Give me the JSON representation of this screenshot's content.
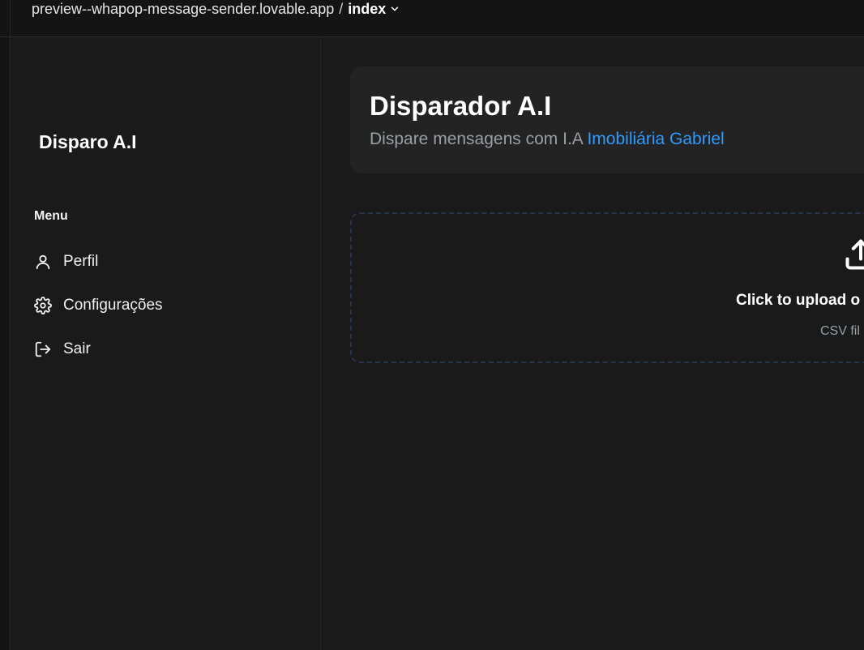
{
  "browser": {
    "url": "preview--whapop-message-sender.lovable.app",
    "separator": "/",
    "page": "index"
  },
  "sidebar": {
    "brand": "Disparo A.I",
    "menu_label": "Menu",
    "items": [
      {
        "label": "Perfil",
        "icon": "user-icon"
      },
      {
        "label": "Configurações",
        "icon": "gear-icon"
      },
      {
        "label": "Sair",
        "icon": "logout-icon"
      }
    ]
  },
  "header": {
    "title": "Disparador A.I",
    "subtitle_prefix": "Dispare mensagens com I.A",
    "subtitle_highlight": "Imobiliária Gabriel"
  },
  "upload": {
    "title": "Click to upload o",
    "hint": "CSV fil",
    "icon": "upload-icon"
  },
  "colors": {
    "background": "#1a1a1b",
    "card": "#232323",
    "accent": "#2f9bff",
    "muted_text": "#9a9ea6",
    "dashed_border": "#26344a"
  }
}
